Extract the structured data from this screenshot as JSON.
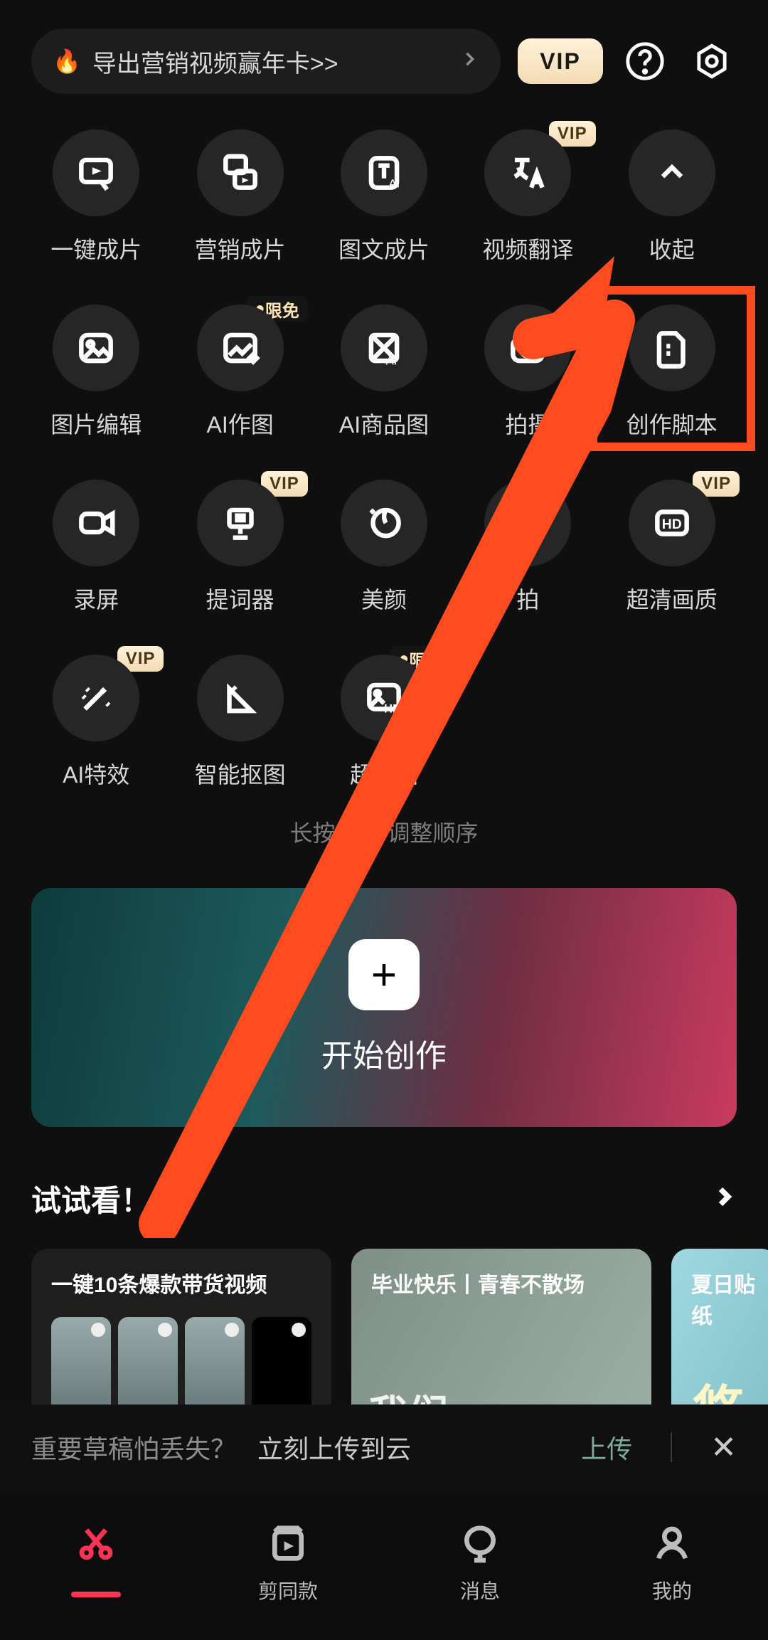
{
  "header": {
    "promo_text": "导出营销视频赢年卡>>",
    "vip_label": "VIP"
  },
  "tools": [
    {
      "label": "一键成片",
      "badge": null
    },
    {
      "label": "营销成片",
      "badge": null
    },
    {
      "label": "图文成片",
      "badge": null
    },
    {
      "label": "视频翻译",
      "badge": "VIP"
    },
    {
      "label": "收起",
      "badge": null
    },
    {
      "label": "图片编辑",
      "badge": null
    },
    {
      "label": "AI作图",
      "badge": "限免"
    },
    {
      "label": "AI商品图",
      "badge": null
    },
    {
      "label": "拍摄",
      "badge": null
    },
    {
      "label": "创作脚本",
      "badge": null
    },
    {
      "label": "录屏",
      "badge": null
    },
    {
      "label": "提词器",
      "badge": "VIP"
    },
    {
      "label": "美颜",
      "badge": null
    },
    {
      "label": "拍",
      "badge": null
    },
    {
      "label": "超清画质",
      "badge": "VIP"
    },
    {
      "label": "AI特效",
      "badge": "VIP"
    },
    {
      "label": "智能抠图",
      "badge": null
    },
    {
      "label": "超清图",
      "badge": "限免"
    }
  ],
  "hint": "长按拖动    调整顺序",
  "banner": {
    "label": "开始创作"
  },
  "try": {
    "title": "试试看！",
    "cards": [
      {
        "title": "一键10条爆款带货视频"
      },
      {
        "title": "毕业快乐丨青春不散场",
        "watermark": "我们"
      },
      {
        "title": "夏日贴纸",
        "char": "悠"
      }
    ]
  },
  "upload": {
    "msg": "重要草稿怕丢失？",
    "link_text": "立刻上传到云",
    "action": "上传"
  },
  "nav": [
    {
      "label": ""
    },
    {
      "label": "剪同款"
    },
    {
      "label": "消息"
    },
    {
      "label": "我的"
    }
  ]
}
